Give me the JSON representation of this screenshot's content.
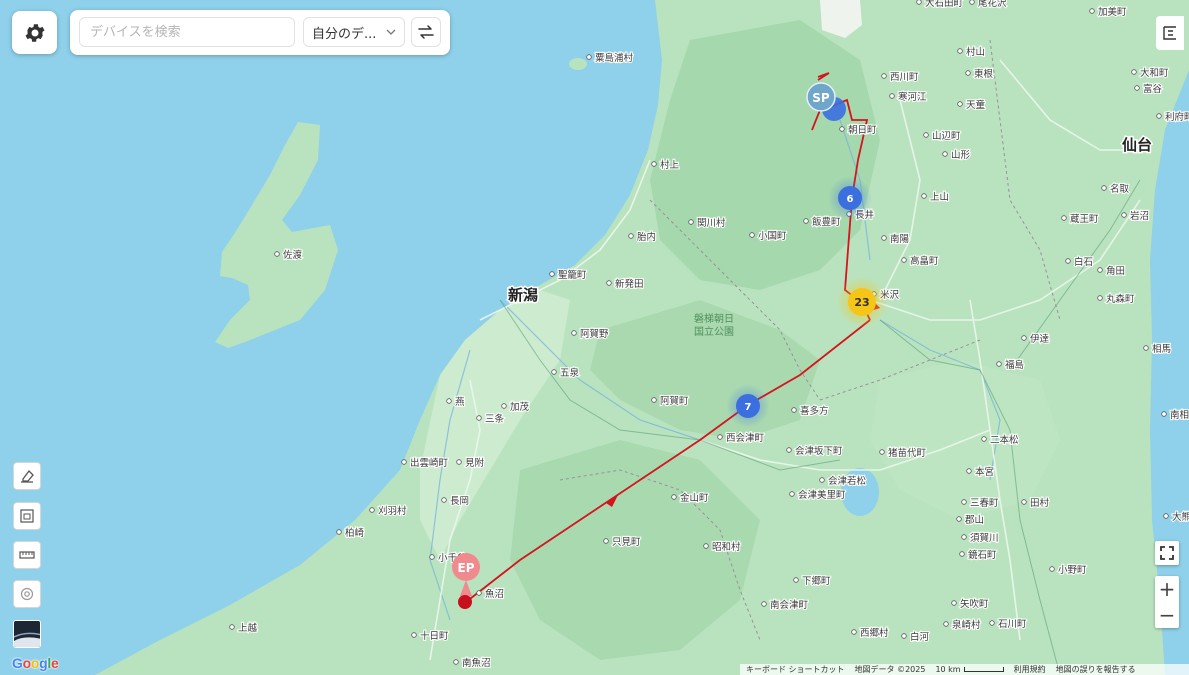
{
  "toolbar": {
    "search_placeholder": "デバイスを検索",
    "device_select": "自分のデ...",
    "gear_icon": "gear-icon",
    "filter_icon": "swap-arrows-icon"
  },
  "map_labels": {
    "cities": [
      {
        "name": "新潟",
        "major": true
      },
      {
        "name": "仙台",
        "major": true
      },
      {
        "name": "福島",
        "major": false
      },
      {
        "name": "郡山",
        "major": false
      },
      {
        "name": "新発田"
      },
      {
        "name": "村上"
      },
      {
        "name": "聖籠町"
      },
      {
        "name": "阿賀野"
      },
      {
        "name": "五泉"
      },
      {
        "name": "加茂"
      },
      {
        "name": "三条"
      },
      {
        "name": "燕"
      },
      {
        "name": "見附"
      },
      {
        "name": "長岡"
      },
      {
        "name": "出雲崎町"
      },
      {
        "name": "刈羽村"
      },
      {
        "name": "柏崎"
      },
      {
        "name": "小千谷"
      },
      {
        "name": "魚沼"
      },
      {
        "name": "十日町"
      },
      {
        "name": "南魚沼"
      },
      {
        "name": "上越"
      },
      {
        "name": "佐渡"
      },
      {
        "name": "粟島浦村"
      },
      {
        "name": "胎内"
      },
      {
        "name": "関川村"
      },
      {
        "name": "小国町"
      },
      {
        "name": "飯豊町"
      },
      {
        "name": "長井"
      },
      {
        "name": "南陽"
      },
      {
        "name": "高畠町"
      },
      {
        "name": "米沢"
      },
      {
        "name": "朝日町"
      },
      {
        "name": "西川町"
      },
      {
        "name": "寒河江"
      },
      {
        "name": "山辺町"
      },
      {
        "name": "山形"
      },
      {
        "name": "上山"
      },
      {
        "name": "天童"
      },
      {
        "name": "東根"
      },
      {
        "name": "村山"
      },
      {
        "name": "大石田町"
      },
      {
        "name": "尾花沢"
      },
      {
        "name": "伊達"
      },
      {
        "name": "相馬"
      },
      {
        "name": "喜多方"
      },
      {
        "name": "阿賀町"
      },
      {
        "name": "西会津町"
      },
      {
        "name": "会津坂下町"
      },
      {
        "name": "会津若松"
      },
      {
        "name": "会津美里町"
      },
      {
        "name": "猪苗代町"
      },
      {
        "name": "二本松"
      },
      {
        "name": "本宮"
      },
      {
        "name": "三春町"
      },
      {
        "name": "田村"
      },
      {
        "name": "須賀川"
      },
      {
        "name": "鏡石町"
      },
      {
        "name": "矢吹町"
      },
      {
        "name": "石川町"
      },
      {
        "name": "小野町"
      },
      {
        "name": "白河"
      },
      {
        "name": "泉崎村"
      },
      {
        "name": "西郷村"
      },
      {
        "name": "下郷町"
      },
      {
        "name": "南会津町"
      },
      {
        "name": "只見町"
      },
      {
        "name": "昭和村"
      },
      {
        "name": "金山町"
      },
      {
        "name": "加美町"
      },
      {
        "name": "大和町"
      },
      {
        "name": "富谷"
      },
      {
        "name": "利府町"
      },
      {
        "name": "名取"
      },
      {
        "name": "蔵王町"
      },
      {
        "name": "岩沼"
      },
      {
        "name": "白石"
      },
      {
        "name": "角田"
      },
      {
        "name": "丸森町"
      },
      {
        "name": "南相馬"
      },
      {
        "name": "大熊町"
      },
      {
        "name": "磐梯朝日\n国立公園"
      }
    ]
  },
  "markers": {
    "start": "SP",
    "end": "EP",
    "clusters": [
      {
        "count": "6",
        "color": "#3b6fe0"
      },
      {
        "count": "23",
        "color": "#f5c518"
      },
      {
        "count": "7",
        "color": "#3b6fe0"
      }
    ]
  },
  "colors": {
    "route": "#d4141e",
    "water": "#8fd0ea",
    "land": "#b9e3bf"
  },
  "left_tools": [
    "eraser-icon",
    "frame-icon",
    "ruler-icon",
    "settings-outline-icon",
    "satellite-layer-icon"
  ],
  "right_controls": {
    "top_button_icon": "route-info-icon",
    "fullscreen_icon": "fullscreen-icon",
    "zoom_in": "+",
    "zoom_out": "−"
  },
  "attribution": {
    "keyboard": "キーボード ショートカット",
    "map_data": "地図データ ©2025",
    "scale": "10 km",
    "terms": "利用規約",
    "report": "地図の誤りを報告する"
  },
  "google_logo": "Google"
}
